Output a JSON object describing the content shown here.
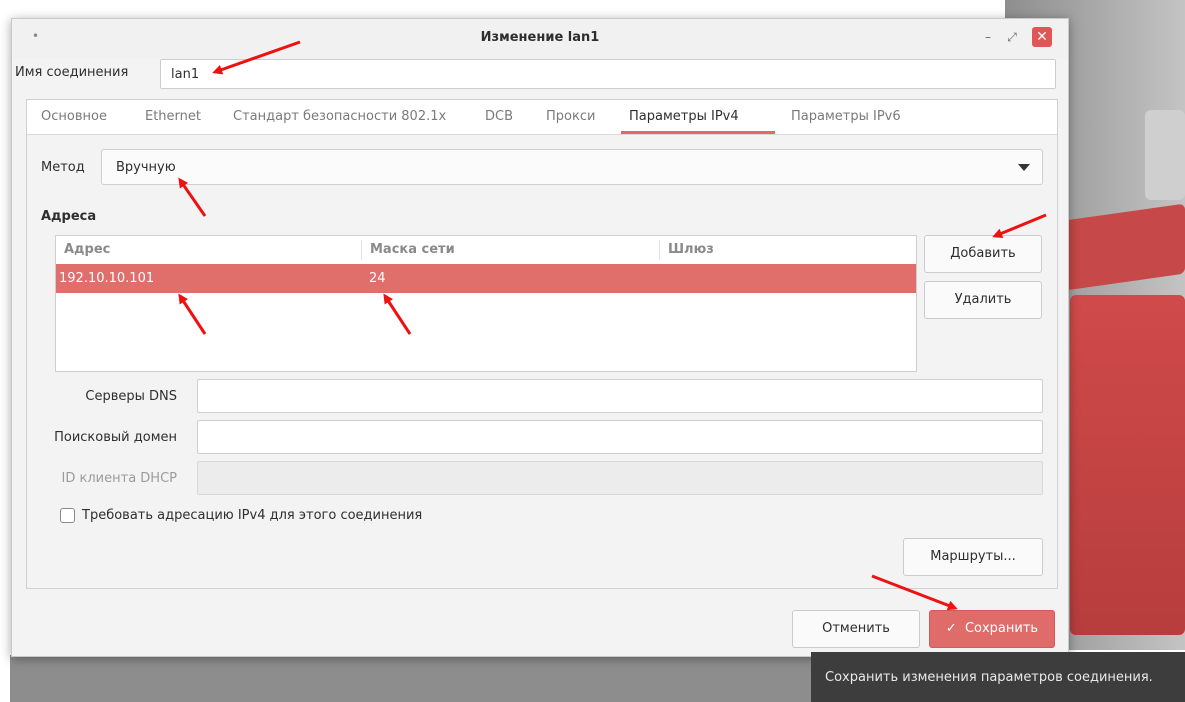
{
  "window": {
    "title": "Изменение lan1",
    "minimize_glyph": "–",
    "maximize_glyph": "⤢",
    "close_glyph": "✕",
    "menu_glyph": "•"
  },
  "connection_name": {
    "label": "Имя соединения",
    "value": "lan1"
  },
  "tabs": [
    {
      "label": "Основное",
      "active": false
    },
    {
      "label": "Ethernet",
      "active": false
    },
    {
      "label": "Стандарт безопасности 802.1x",
      "active": false
    },
    {
      "label": "DCB",
      "active": false
    },
    {
      "label": "Прокси",
      "active": false
    },
    {
      "label": "Параметры IPv4",
      "active": true
    },
    {
      "label": "Параметры IPv6",
      "active": false
    }
  ],
  "ipv4": {
    "method_label": "Метод",
    "method_value": "Вручную",
    "addresses_heading": "Адреса",
    "columns": [
      "Адрес",
      "Маска сети",
      "Шлюз"
    ],
    "rows": [
      {
        "address": "192.10.10.101",
        "netmask": "24",
        "gateway": ""
      }
    ],
    "add_button": "Добавить",
    "delete_button": "Удалить",
    "dns_label": "Серверы DNS",
    "dns_value": "",
    "search_domain_label": "Поисковый домен",
    "search_domain_value": "",
    "dhcp_client_id_label": "ID клиента DHCP",
    "dhcp_client_id_value": "",
    "require_ipv4_label": "Требовать адресацию IPv4 для этого соединения",
    "require_ipv4_checked": false,
    "routes_button": "Маршруты..."
  },
  "footer": {
    "cancel_button": "Отменить",
    "save_button": "Сохранить",
    "save_icon": "✓"
  },
  "tooltip": {
    "text": "Сохранить изменения параметров соединения."
  },
  "colors": {
    "accent": "#e06c69",
    "selected_row": "#e06e6a",
    "annotation_arrow": "#ee1111"
  }
}
